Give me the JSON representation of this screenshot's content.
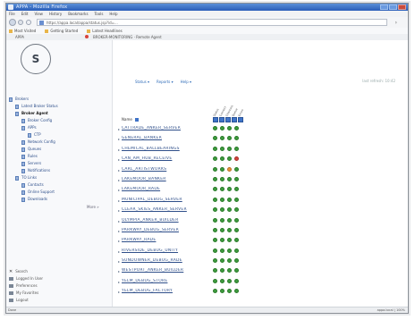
{
  "window": {
    "title": "APPA - Mozilla Firefox"
  },
  "menubar": [
    "File",
    "Edit",
    "View",
    "History",
    "Bookmarks",
    "Tools",
    "Help"
  ],
  "address": {
    "url": "https://appa.local/appa/status.jsp?id=..."
  },
  "bookmarks": [
    "Most Visited",
    "Getting Started",
    "Latest Headlines"
  ],
  "app_header": {
    "left": "APPA",
    "session": "BROKER-MONITORING · Remote Agent"
  },
  "sidebar": {
    "logo_text": "S",
    "tree": [
      {
        "label": "Brokers",
        "level": 0
      },
      {
        "label": "Latest Broker Status",
        "level": 1
      },
      {
        "label": "Broker Agent",
        "level": 1,
        "active": true
      },
      {
        "label": "Broker Config",
        "level": 2
      },
      {
        "label": "APPs",
        "level": 2
      },
      {
        "label": "CTP",
        "level": 3
      },
      {
        "label": "Network Config",
        "level": 2
      },
      {
        "label": "Queues",
        "level": 2
      },
      {
        "label": "Rules",
        "level": 2
      },
      {
        "label": "Servers",
        "level": 2
      },
      {
        "label": "Notifications",
        "level": 2
      },
      {
        "label": "TO Links",
        "level": 1
      },
      {
        "label": "Contacts",
        "level": 2
      },
      {
        "label": "Online Support",
        "level": 2
      },
      {
        "label": "Downloads",
        "level": 2
      }
    ],
    "tree_more": "More »",
    "bottom_items": [
      "Search",
      "Logged In User",
      "Preferences",
      "My Favorites",
      "Logout"
    ]
  },
  "toolbar": {
    "items": [
      "Status ▾",
      "Reports ▾",
      "Help ▾"
    ]
  },
  "top_right_link": "last refresh: 10:42",
  "columns": [
    "Status",
    "Connect",
    "Channels",
    "Queue",
    "Errors"
  ],
  "name_header": "Name",
  "rows": [
    {
      "name": "CATTRADE_ANKER_SERVER",
      "status": [
        "g",
        "g",
        "g",
        "g"
      ]
    },
    {
      "name": "GENERAL_BANKER",
      "status": [
        "g",
        "g",
        "g",
        "g"
      ]
    },
    {
      "name": "CHEMICAL_BALLBEARINGS",
      "status": [
        "g",
        "g",
        "g",
        "g"
      ]
    },
    {
      "name": "CAN_AM_HUB_RECEIVE",
      "status": [
        "g",
        "g",
        "g",
        "r"
      ]
    },
    {
      "name": "CARL_ARTISTWORKS",
      "status": [
        "g",
        "g",
        "o",
        "g"
      ]
    },
    {
      "name": "LAKEMOOR_BANKER",
      "status": [
        "g",
        "g",
        "g",
        "g"
      ]
    },
    {
      "name": "LAKEMOOR_RADE",
      "status": [
        "g",
        "g",
        "g",
        "g"
      ]
    },
    {
      "name": "MUNICIPAL_DEBUG_SERVER",
      "status": [
        "g",
        "g",
        "g",
        "g"
      ]
    },
    {
      "name": "CLEAR_SKIES_ANKER_SERVER",
      "status": [
        "g",
        "g",
        "g",
        "g"
      ]
    },
    {
      "name": "OLYMPIA_ANKER_BUILDER",
      "status": [
        "g",
        "g",
        "g",
        "g"
      ]
    },
    {
      "name": "PARKWAY_DEBUG_SERVER",
      "status": [
        "g",
        "g",
        "g",
        "g"
      ]
    },
    {
      "name": "PARKWAY_RADE",
      "status": [
        "g",
        "g",
        "g",
        "g"
      ]
    },
    {
      "name": "RIVERSIDE_DEBUG_UNITY",
      "status": [
        "g",
        "g",
        "g",
        "g"
      ]
    },
    {
      "name": "SUNDOWNER_DEBUG_RADE",
      "status": [
        "g",
        "g",
        "g",
        "g"
      ]
    },
    {
      "name": "WESTPORT_ANKER_BUILDER",
      "status": [
        "g",
        "g",
        "g",
        "g"
      ]
    },
    {
      "name": "YELM_DEBUG_STORE",
      "status": [
        "g",
        "g",
        "g",
        "g"
      ]
    },
    {
      "name": "YELM_DEBUG_FACTORY",
      "status": [
        "g",
        "g",
        "g",
        "g"
      ]
    }
  ],
  "statusbar": {
    "left": "Done",
    "right": "appa.local | 100%"
  }
}
